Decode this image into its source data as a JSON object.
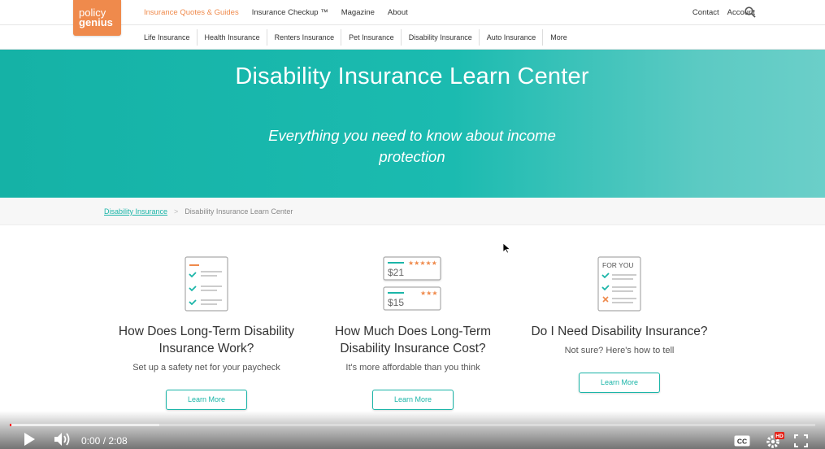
{
  "logo": {
    "line1": "policy",
    "line2": "genius"
  },
  "nav": {
    "main": [
      "Insurance Quotes & Guides",
      "Insurance Checkup ™",
      "Magazine",
      "About"
    ],
    "right": [
      "Contact",
      "Account"
    ]
  },
  "subnav": [
    "Life Insurance",
    "Health Insurance",
    "Renters Insurance",
    "Pet Insurance",
    "Disability Insurance",
    "Auto Insurance",
    "More"
  ],
  "hero": {
    "title": "Disability Insurance Learn Center",
    "subtitle": "Everything you need to know about income protection"
  },
  "breadcrumb": {
    "parent": "Disability Insurance",
    "separator": ">",
    "current": "Disability Insurance Learn Center"
  },
  "cards": [
    {
      "title": "How Does Long-Term Disability Insurance Work?",
      "desc": "Set up a safety net for your paycheck",
      "button": "Learn More"
    },
    {
      "title": "How Much Does Long-Term Disability Insurance Cost?",
      "desc": "It's more affordable than you think",
      "button": "Learn More",
      "prices": [
        "$21",
        "$15"
      ]
    },
    {
      "title": "Do I Need Disability Insurance?",
      "desc": "Not sure? Here's how to tell",
      "button": "Learn More",
      "icon_label": "FOR YOU"
    }
  ],
  "video": {
    "time": "0:00 / 2:08",
    "progress_fraction": 0.002,
    "loaded_fraction": 0.186,
    "cc_label": "CC",
    "hd_label": "HD"
  },
  "colors": {
    "brand_orange": "#ef8a4c",
    "teal": "#1bb5a8"
  }
}
